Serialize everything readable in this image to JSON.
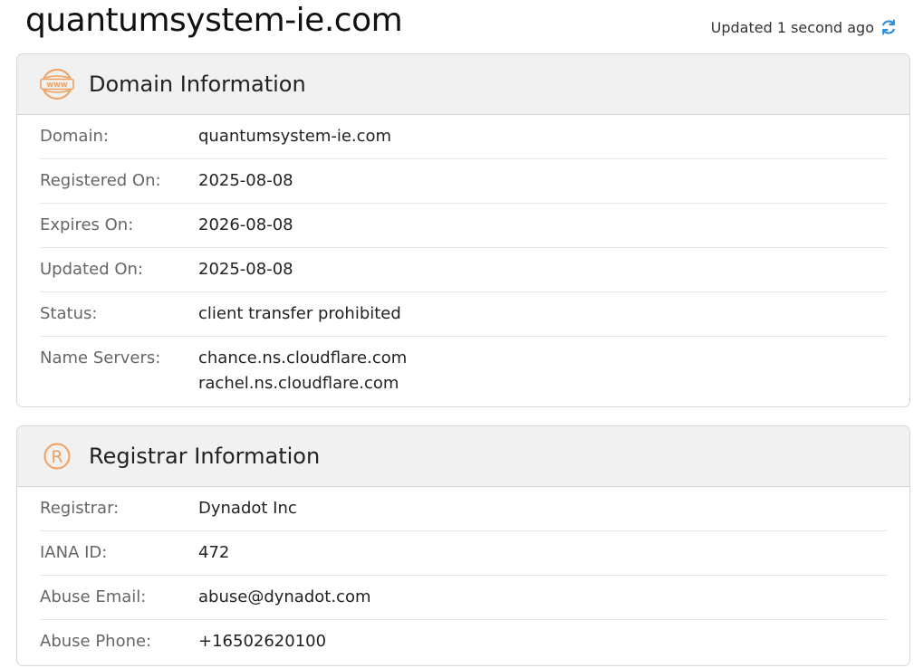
{
  "header": {
    "title": "quantumsystem-ie.com",
    "updated_text": "Updated 1 second ago"
  },
  "colors": {
    "accent_orange": "#f0a060",
    "refresh_blue": "#2a8fe0"
  },
  "icons": {
    "domain": "www-globe-icon",
    "registrar": "registered-icon",
    "refresh": "refresh-icon"
  },
  "domain_info": {
    "title": "Domain Information",
    "rows": [
      {
        "label": "Domain:",
        "value": "quantumsystem-ie.com"
      },
      {
        "label": "Registered On:",
        "value": "2025-08-08"
      },
      {
        "label": "Expires On:",
        "value": "2026-08-08"
      },
      {
        "label": "Updated On:",
        "value": "2025-08-08"
      },
      {
        "label": "Status:",
        "value": "client transfer prohibited"
      },
      {
        "label": "Name Servers:",
        "values": [
          "chance.ns.cloudflare.com",
          "rachel.ns.cloudflare.com"
        ]
      }
    ]
  },
  "registrar_info": {
    "title": "Registrar Information",
    "rows": [
      {
        "label": "Registrar:",
        "value": "Dynadot Inc"
      },
      {
        "label": "IANA ID:",
        "value": "472"
      },
      {
        "label": "Abuse Email:",
        "value": "abuse@dynadot.com"
      },
      {
        "label": "Abuse Phone:",
        "value": "+16502620100"
      }
    ]
  }
}
